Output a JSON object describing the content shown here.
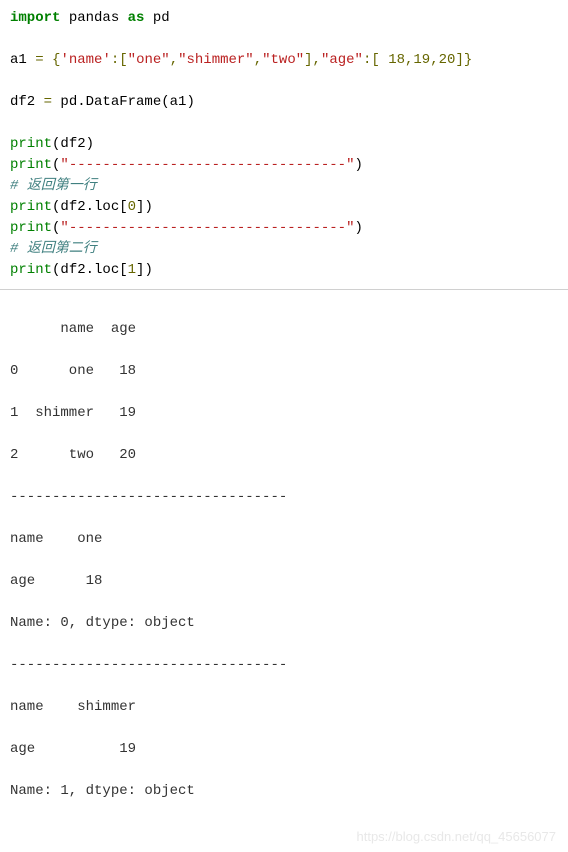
{
  "code": {
    "l1_kw": "import",
    "l1_mod": " pandas ",
    "l1_as": "as",
    "l1_alias": " pd",
    "l3_var": "a1 ",
    "l3_eq": "=",
    "l3_sp": " ",
    "l3_brace_open": "{",
    "l3_key1": "'name'",
    "l3_colon1": ":",
    "l3_br1o": "[",
    "l3_v1": "\"one\"",
    "l3_c1": ",",
    "l3_v2": "\"shimmer\"",
    "l3_c2": ",",
    "l3_v3": "\"two\"",
    "l3_br1c": "],",
    "l3_key2": "\"age\"",
    "l3_colon2": ":",
    "l3_br2o": "[ ",
    "l3_n1": "18",
    "l3_c3": ",",
    "l3_n2": "19",
    "l3_c4": ",",
    "l3_n3": "20",
    "l3_br2c": "]}",
    "l5_var": "df2 ",
    "l5_eq": "=",
    "l5_rest": " pd.DataFrame(a1)",
    "l7_print": "print",
    "l7_arg": "(df2)",
    "l8_print": "print",
    "l8_po": "(",
    "l8_str": "\"---------------------------------\"",
    "l8_pc": ")",
    "l9_comment": "# 返回第一行",
    "l10_print": "print",
    "l10_po": "(df2.loc[",
    "l10_num": "0",
    "l10_pc": "])",
    "l11_print": "print",
    "l11_po": "(",
    "l11_str": "\"---------------------------------\"",
    "l11_pc": ")",
    "l12_comment": "# 返回第二行",
    "l13_print": "print",
    "l13_po": "(df2.loc[",
    "l13_num": "1",
    "l13_pc": "])"
  },
  "output": {
    "line1": "      name  age",
    "line2": "0      one   18",
    "line3": "1  shimmer   19",
    "line4": "2      two   20",
    "line5": "---------------------------------",
    "line6": "name    one",
    "line7": "age      18",
    "line8": "Name: 0, dtype: object",
    "line9": "---------------------------------",
    "line10": "name    shimmer",
    "line11": "age          19",
    "line12": "Name: 1, dtype: object"
  },
  "watermark": "https://blog.csdn.net/qq_45656077"
}
